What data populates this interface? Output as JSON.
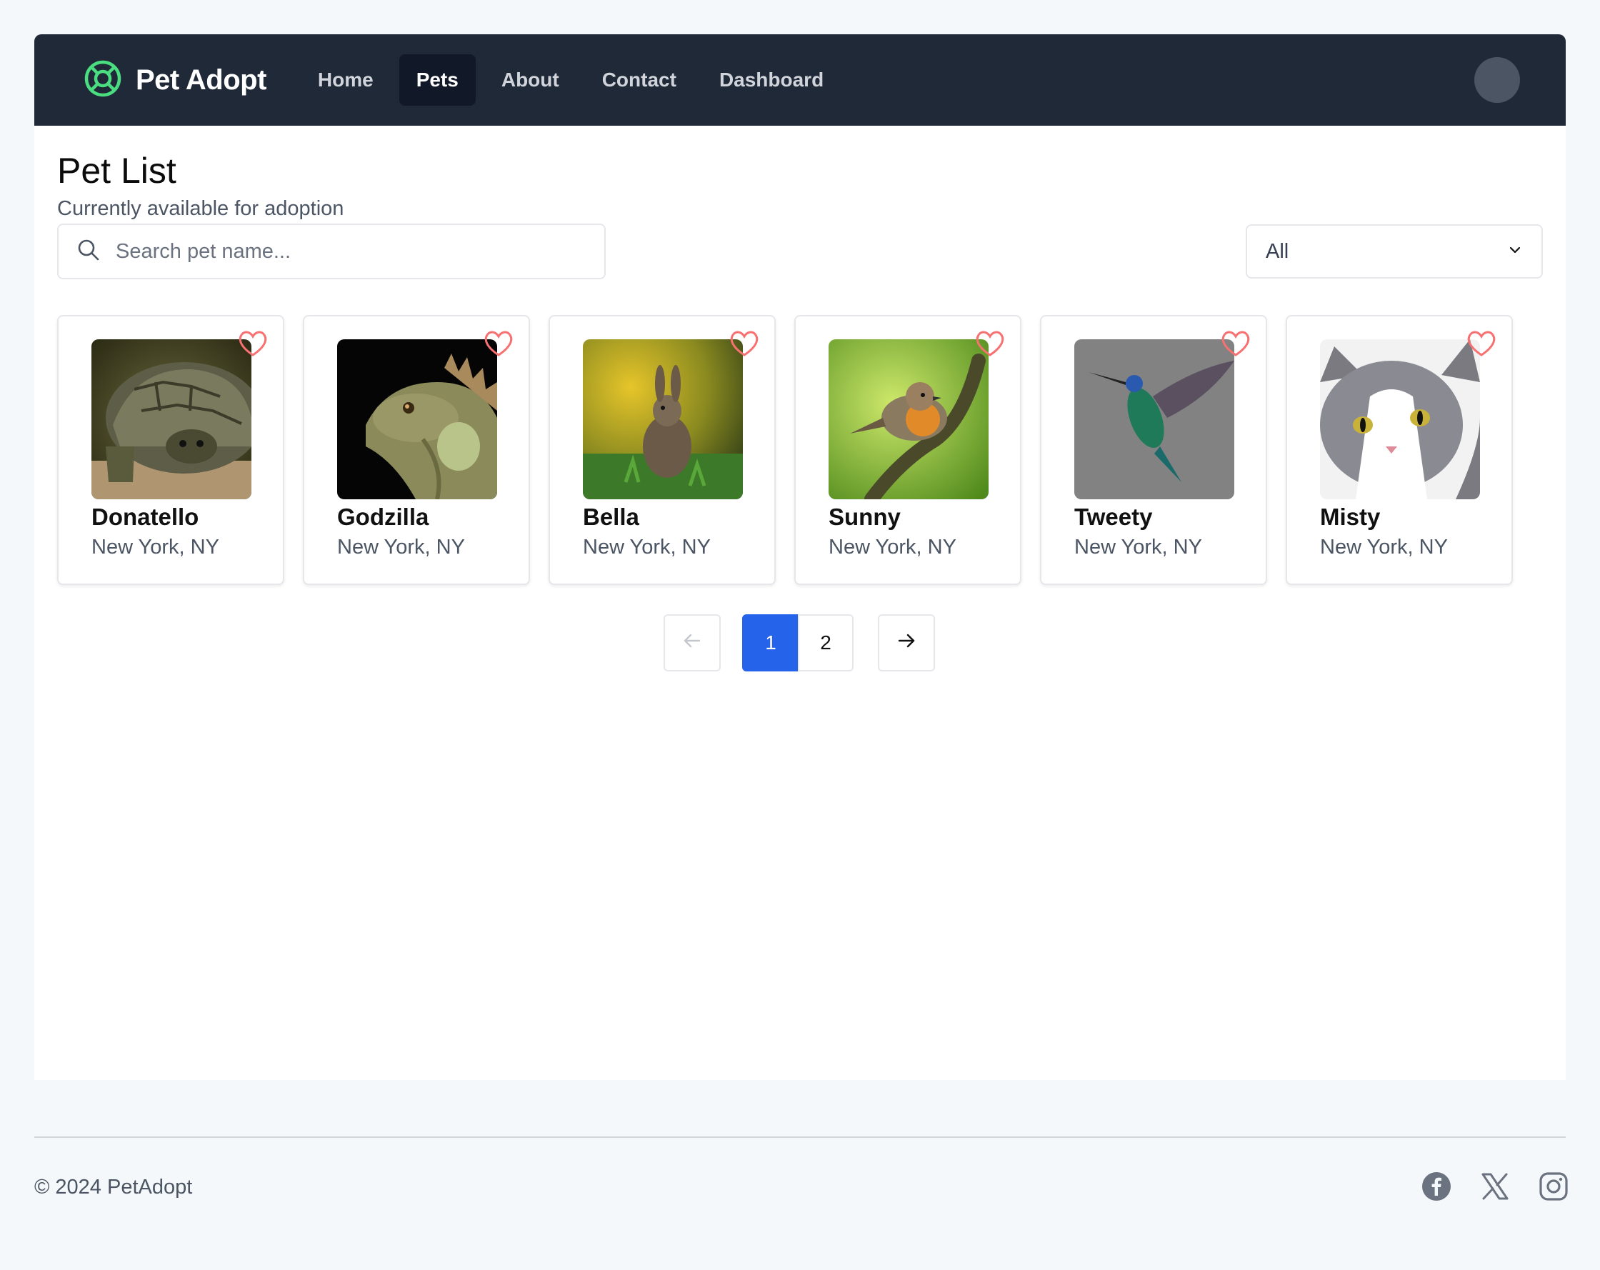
{
  "brand": {
    "name": "Pet Adopt",
    "logo_icon": "lifebuoy-icon",
    "logo_color": "#4ade80"
  },
  "nav": {
    "items": [
      {
        "label": "Home",
        "active": false
      },
      {
        "label": "Pets",
        "active": true
      },
      {
        "label": "About",
        "active": false
      },
      {
        "label": "Contact",
        "active": false
      },
      {
        "label": "Dashboard",
        "active": false
      }
    ]
  },
  "page": {
    "title": "Pet List",
    "subtitle": "Currently available for adoption"
  },
  "search": {
    "placeholder": "Search pet name...",
    "value": ""
  },
  "filter": {
    "selected": "All"
  },
  "pets": [
    {
      "name": "Donatello",
      "location": "New York, NY",
      "image": "tortoise"
    },
    {
      "name": "Godzilla",
      "location": "New York, NY",
      "image": "iguana"
    },
    {
      "name": "Bella",
      "location": "New York, NY",
      "image": "rabbit"
    },
    {
      "name": "Sunny",
      "location": "New York, NY",
      "image": "robin"
    },
    {
      "name": "Tweety",
      "location": "New York, NY",
      "image": "hummingbird"
    },
    {
      "name": "Misty",
      "location": "New York, NY",
      "image": "cat"
    }
  ],
  "pagination": {
    "pages": [
      "1",
      "2"
    ],
    "current": "1"
  },
  "footer": {
    "copyright": "© 2024 PetAdopt",
    "socials": [
      "facebook-icon",
      "x-icon",
      "instagram-icon"
    ]
  },
  "colors": {
    "navbar": "#1f2937",
    "accent": "#2563eb",
    "heart": "#f87171"
  }
}
